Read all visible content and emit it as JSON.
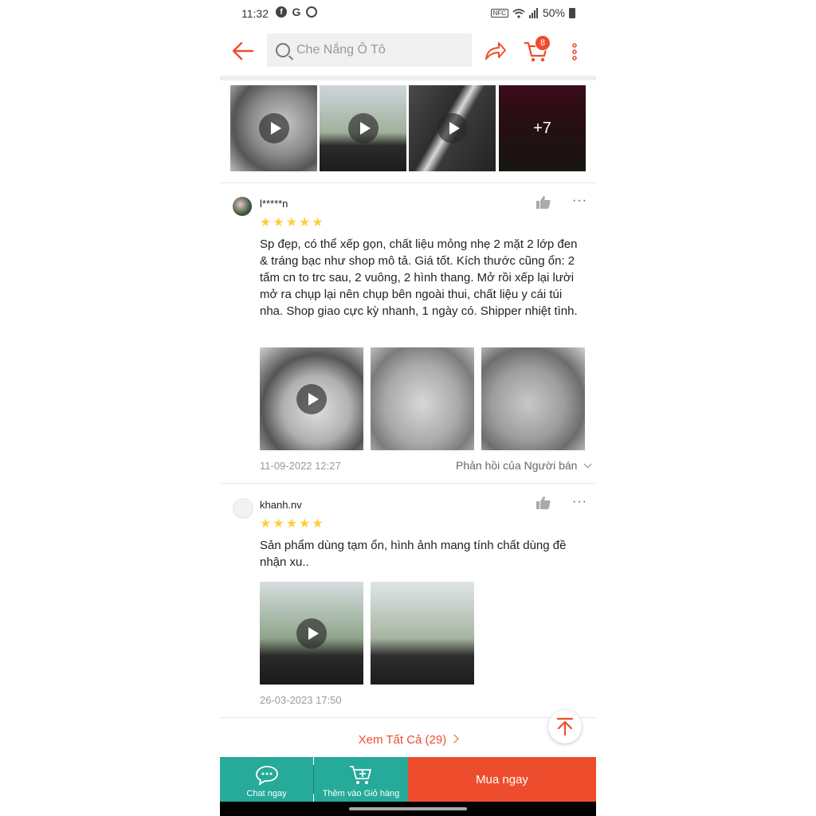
{
  "status_bar": {
    "time": "11:32",
    "battery": "50%"
  },
  "header": {
    "search_placeholder": "Che Nắng Ô Tô",
    "cart_count": "8"
  },
  "gallery": {
    "more_count": "+7"
  },
  "reviews": [
    {
      "username": "l*****n",
      "rating": 5,
      "text": "Sp đẹp, có thể xếp gọn, chất liệu mỏng nhẹ 2 mặt 2 lớp đen & tráng bạc như shop mô tả. Giá tốt. Kích thước cũng ổn: 2 tấm cn to trc sau, 2 vuông, 2 hình thang. Mở rồi xếp lại lười mở ra chụp lại nên chụp bên ngoài thui, chất liệu y cái túi nha. Shop giao cực kỳ nhanh, 1 ngày có. Shipper nhiệt tình.",
      "date": "11-09-2022 12:27",
      "reply_label": "Phản hồi của Người bán"
    },
    {
      "username": "khanh.nv",
      "rating": 5,
      "text": "Sản phẩm dùng tạm ổn, hình ảnh mang tính chất dùng đề nhận xu..",
      "date": "26-03-2023 17:50"
    }
  ],
  "see_all": "Xem Tất Cả (29)",
  "bottom_bar": {
    "chat_label": "Chat ngay",
    "add_to_cart_label": "Thêm vào Giỏ hàng",
    "buy_label": "Mua ngay"
  },
  "colors": {
    "accent": "#ee4d2d",
    "teal": "#26aa99",
    "star": "#ffce3d"
  }
}
